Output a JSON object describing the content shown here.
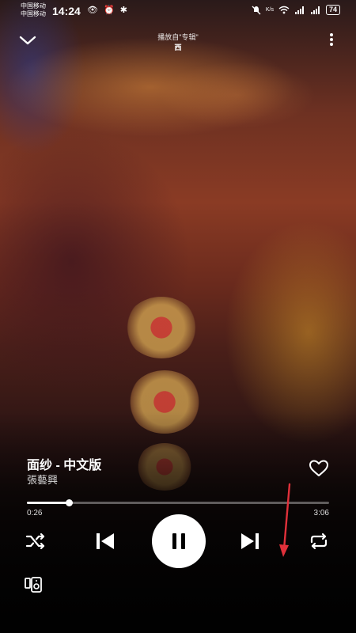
{
  "status_bar": {
    "carrier_1": "中国移动",
    "carrier_2": "中国移动",
    "time": "14:24",
    "left_icons": "👁 ⏰ ✱",
    "speed": "K/s",
    "battery": "74"
  },
  "header": {
    "playing_from": "播放自\"专辑\"",
    "album": "西"
  },
  "track": {
    "title": "面纱 - 中文版",
    "artist": "張藝興"
  },
  "progress": {
    "elapsed": "0:26",
    "total": "3:06",
    "fraction": 0.14
  },
  "colors": {
    "annotation_arrow": "#e0303a"
  },
  "icons": [
    "chevron-down-icon",
    "more-vertical-icon",
    "heart-icon",
    "shuffle-icon",
    "skip-previous-icon",
    "pause-icon",
    "skip-next-icon",
    "repeat-icon",
    "device-connect-icon"
  ]
}
